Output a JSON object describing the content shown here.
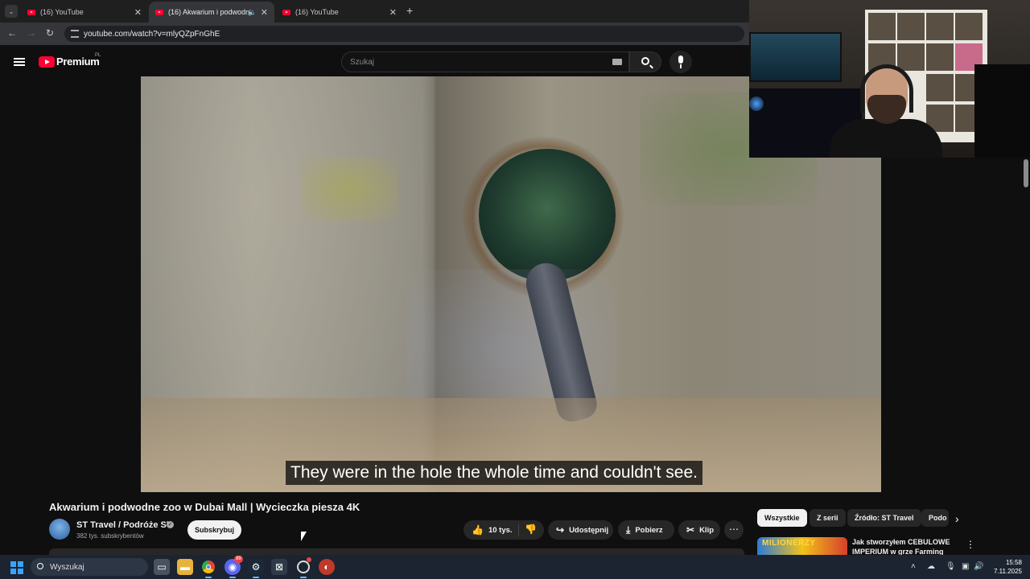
{
  "browser": {
    "tabs": [
      {
        "label": "(16) YouTube",
        "active": false
      },
      {
        "label": "(16) Akwarium i podwodne",
        "active": true,
        "audio": true
      },
      {
        "label": "(16) YouTube",
        "active": false
      }
    ],
    "url": "youtube.com/watch?v=mlyQZpFnGhE"
  },
  "youtube": {
    "logo_text": "Premium",
    "country": "PL",
    "search_placeholder": "Szukaj"
  },
  "video": {
    "caption": "They were in the hole the whole time and couldn't see."
  },
  "watch": {
    "title": "Akwarium i podwodne zoo w Dubai Mall | Wycieczka piesza 4K",
    "channel_name": "ST Travel / Podróże ST",
    "subscribers": "382 tys. subskrybentów",
    "subscribe_label": "Subskrybuj",
    "likes": "10 tys.",
    "share_label": "Udostępnij",
    "download_label": "Pobierz",
    "clip_label": "Klip"
  },
  "chips": [
    "Wszystkie",
    "Z serii",
    "Źródło: ST Travel",
    "Podo"
  ],
  "recommendation": {
    "title": "Jak stworzyłem CEBULOWE IMPERIUM w grze Farming",
    "thumb_text": "MILIONERZY"
  },
  "taskbar": {
    "search_placeholder": "Wyszukaj",
    "time": "15:58",
    "date": "7.11.2025",
    "discord_badge": "99"
  },
  "colors": {
    "youtube_red": "#ff0033",
    "background": "#0f0f0f",
    "chip_selected": "#f1f1f1"
  }
}
